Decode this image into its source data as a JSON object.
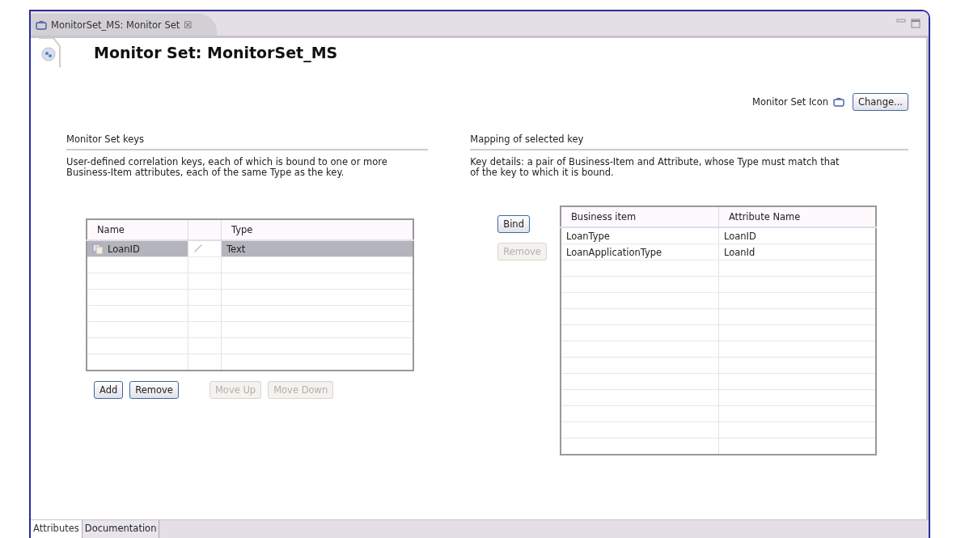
{
  "editor_tab": {
    "title": "MonitorSet_MS: Monitor Set",
    "close": "☒"
  },
  "header": {
    "title": "Monitor Set: MonitorSet_MS"
  },
  "icon_row": {
    "label": "Monitor Set Icon",
    "button": {
      "label": "Change...",
      "disabled": false
    }
  },
  "keys_section": {
    "title": "Monitor Set keys",
    "description": "User-defined correlation keys, each of which is bound to one or more Business-Item attributes, each of the same Type as the key.",
    "table": {
      "columns": [
        "Name",
        "",
        "Type"
      ],
      "rows": [
        {
          "name": "LoanID",
          "type": "Text",
          "selected": true
        }
      ]
    },
    "buttons": [
      {
        "label": "Add",
        "disabled": false
      },
      {
        "label": "Remove",
        "disabled": false
      },
      {
        "label": "Move Up",
        "disabled": true
      },
      {
        "label": "Move Down",
        "disabled": true
      }
    ]
  },
  "mapping_section": {
    "title": "Mapping of selected key",
    "description": "Key details: a pair of Business-Item and Attribute, whose Type must match that of the key to which it is bound.",
    "buttons": [
      {
        "label": "Bind",
        "disabled": false
      },
      {
        "label": "Remove",
        "disabled": true
      }
    ],
    "table": {
      "columns": [
        "Business item",
        "Attribute Name"
      ],
      "rows": [
        [
          "LoanType",
          "LoanID"
        ],
        [
          "LoanApplicationType",
          "LoanId"
        ]
      ]
    }
  },
  "bottom_tabs": [
    {
      "label": "Attributes",
      "selected": true
    },
    {
      "label": "Documentation",
      "selected": false
    }
  ]
}
